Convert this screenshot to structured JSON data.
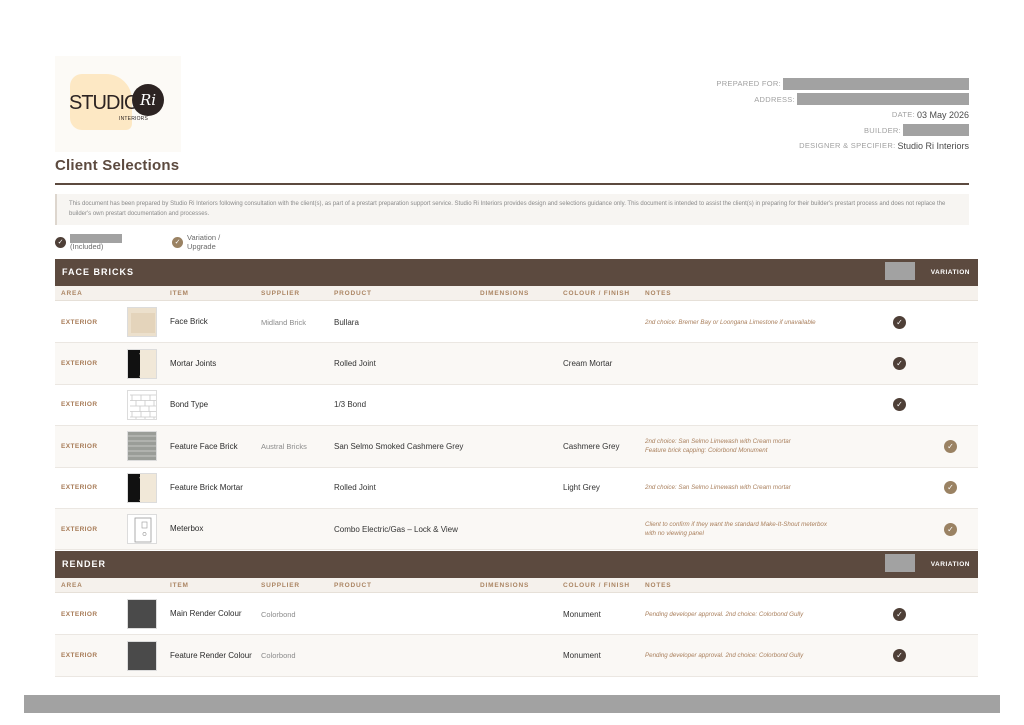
{
  "logo": {
    "brand": "STUDIO",
    "monogram": "Ri",
    "sub": "INTERIORS"
  },
  "meta": {
    "prepared_for_label": "PREPARED FOR:",
    "address_label": "ADDRESS:",
    "date_label": "DATE:",
    "date_value": "03 May 2026",
    "builder_label": "BUILDER:",
    "designer_label": "DESIGNER & SPECIFIER:",
    "designer_value": "Studio Ri Interiors"
  },
  "title": "Client Selections",
  "disclaimer": "This document has been prepared by Studio Ri Interiors following consultation with the client(s), as part of a prestart preparation support service. Studio Ri Interiors provides design and selections guidance only. This document is intended to assist the client(s) in preparing for their builder's prestart process and does not replace the builder's own prestart documentation and processes.",
  "legend": {
    "included": "(Included)",
    "variation_line1": "Variation /",
    "variation_line2": "Upgrade"
  },
  "check_glyph": "✓",
  "columns": {
    "area": "AREA",
    "item": "ITEM",
    "supplier": "SUPPLIER",
    "product": "PRODUCT",
    "dimensions": "DIMENSIONS",
    "colour": "COLOUR / FINISH",
    "notes": "NOTES"
  },
  "sections": [
    {
      "title": "FACE BRICKS",
      "variation_label": "VARIATION",
      "rows": [
        {
          "area": "EXTERIOR",
          "item": "Face Brick",
          "supplier": "Midland Brick",
          "product": "Bullara",
          "dimensions": "",
          "colour": "",
          "notes": "2nd choice: Bremer Bay or Loongana Limestone if unavailable",
          "status": "included",
          "thumb": "cream-brick"
        },
        {
          "area": "EXTERIOR",
          "item": "Mortar Joints",
          "supplier": "",
          "product": "Rolled Joint",
          "dimensions": "",
          "colour": "Cream Mortar",
          "notes": "",
          "status": "included",
          "thumb": "mortar-joint"
        },
        {
          "area": "EXTERIOR",
          "item": "Bond Type",
          "supplier": "",
          "product": "1/3 Bond",
          "dimensions": "",
          "colour": "",
          "notes": "",
          "status": "included",
          "thumb": "bond-pattern"
        },
        {
          "area": "EXTERIOR",
          "item": "Feature Face Brick",
          "supplier": "Austral Bricks",
          "product": "San Selmo Smoked Cashmere Grey",
          "dimensions": "",
          "colour": "Cashmere Grey",
          "notes": "2nd choice: San Selmo Limewash with Cream mortar\nFeature brick capping: Colorbond Monument",
          "status": "variation",
          "thumb": "grey-brick"
        },
        {
          "area": "EXTERIOR",
          "item": "Feature Brick Mortar",
          "supplier": "",
          "product": "Rolled Joint",
          "dimensions": "",
          "colour": "Light Grey",
          "notes": "2nd choice: San Selmo Limewash with Cream mortar",
          "status": "variation",
          "thumb": "mortar-joint"
        },
        {
          "area": "EXTERIOR",
          "item": "Meterbox",
          "supplier": "",
          "product": "Combo Electric/Gas – Lock & View",
          "dimensions": "",
          "colour": "",
          "notes": "Client to confirm if they want the standard Make-It-Shout meterbox\nwith no viewing panel",
          "status": "variation",
          "thumb": "meterbox"
        }
      ]
    },
    {
      "title": "RENDER",
      "variation_label": "VARIATION",
      "rows": [
        {
          "area": "EXTERIOR",
          "item": "Main Render Colour",
          "supplier": "Colorbond",
          "product": "",
          "dimensions": "",
          "colour": "Monument",
          "notes": "Pending developer approval. 2nd choice: Colorbond Gully",
          "status": "included",
          "thumb": "dark-swatch"
        },
        {
          "area": "EXTERIOR",
          "item": "Feature Render Colour",
          "supplier": "Colorbond",
          "product": "",
          "dimensions": "",
          "colour": "Monument",
          "notes": "Pending developer approval. 2nd choice: Colorbond Gully",
          "status": "included",
          "thumb": "dark-swatch"
        }
      ]
    }
  ],
  "colors": {
    "brand_brown": "#5c4a3f",
    "accent_tan": "#a87c58",
    "check_included": "#4e3f37",
    "check_variation": "#9a8263"
  }
}
